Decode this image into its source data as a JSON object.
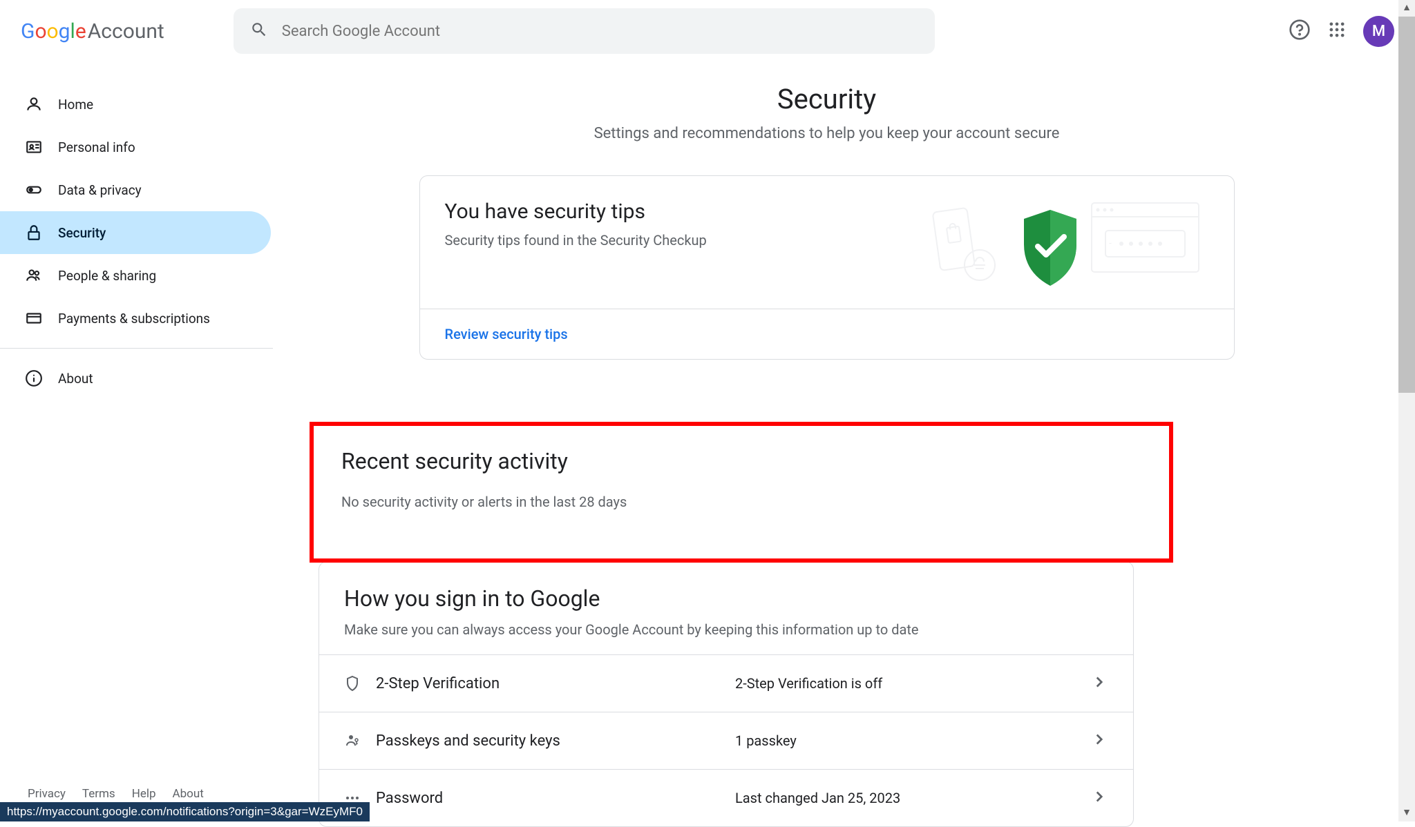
{
  "header": {
    "logo_account": "Account",
    "search_placeholder": "Search Google Account",
    "avatar_initial": "M"
  },
  "sidebar": {
    "items": [
      {
        "label": "Home"
      },
      {
        "label": "Personal info"
      },
      {
        "label": "Data & privacy"
      },
      {
        "label": "Security"
      },
      {
        "label": "People & sharing"
      },
      {
        "label": "Payments & subscriptions"
      },
      {
        "label": "About"
      }
    ]
  },
  "page": {
    "title": "Security",
    "subtitle": "Settings and recommendations to help you keep your account secure"
  },
  "tips_card": {
    "title": "You have security tips",
    "subtitle": "Security tips found in the Security Checkup",
    "action": "Review security tips"
  },
  "activity": {
    "title": "Recent security activity",
    "subtitle": "No security activity or alerts in the last 28 days"
  },
  "signin": {
    "title": "How you sign in to Google",
    "subtitle": "Make sure you can always access your Google Account by keeping this information up to date",
    "rows": [
      {
        "label": "2-Step Verification",
        "value": "2-Step Verification is off"
      },
      {
        "label": "Passkeys and security keys",
        "value": "1 passkey"
      },
      {
        "label": "Password",
        "value": "Last changed Jan 25, 2023"
      }
    ]
  },
  "footer": {
    "links": [
      "Privacy",
      "Terms",
      "Help",
      "About"
    ],
    "status_url": "https://myaccount.google.com/notifications?origin=3&gar=WzEyMF0"
  }
}
